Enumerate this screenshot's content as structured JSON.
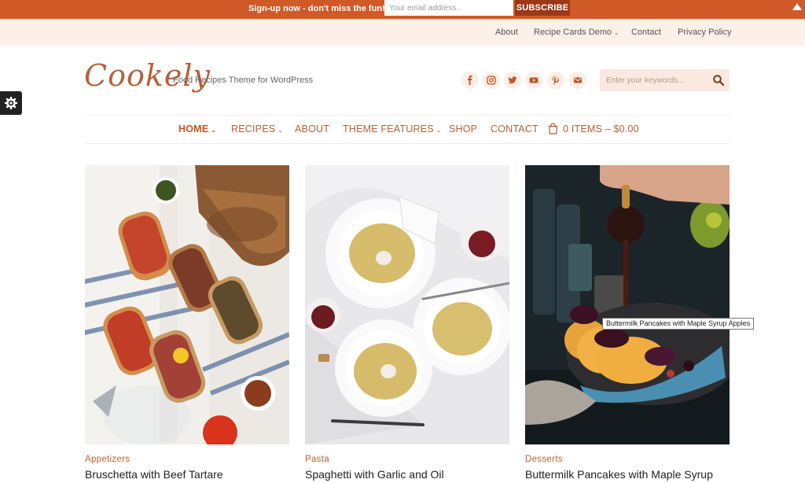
{
  "promo": {
    "text": "Sign-up now - don't miss the fun!",
    "email_placeholder": "Your email address..",
    "subscribe_label": "SUBSCRIBE"
  },
  "subnav": {
    "items": [
      {
        "label": "About"
      },
      {
        "label": "Recipe Cards Demo",
        "has_dropdown": true
      },
      {
        "label": "Contact"
      },
      {
        "label": "Privacy Policy"
      }
    ]
  },
  "header": {
    "logo": "Cookely",
    "tagline": "Food Recipes Theme for WordPress",
    "social_icons": [
      "facebook-icon",
      "instagram-icon",
      "twitter-icon",
      "youtube-icon",
      "pinterest-icon",
      "email-icon"
    ],
    "search_placeholder": "Enter your keywords...",
    "accent_color": "#c45625"
  },
  "nav": {
    "items": [
      {
        "label": "HOME",
        "has_dropdown": true,
        "active": true
      },
      {
        "label": "RECIPES",
        "has_dropdown": true
      },
      {
        "label": "ABOUT"
      },
      {
        "label": "THEME FEATURES",
        "has_dropdown": true
      },
      {
        "label": "SHOP"
      },
      {
        "label": "CONTACT"
      }
    ],
    "cart": "0 ITEMS – $0.00"
  },
  "cards": [
    {
      "category": "Appetizers",
      "title": "Bruschetta with Beef Tartare"
    },
    {
      "category": "Pasta",
      "title": "Spaghetti with Garlic and Oil"
    },
    {
      "category": "Desserts",
      "title": "Buttermilk Pancakes with Maple Syrup"
    }
  ],
  "tooltip": "Buttermilk Pancakes with Maple Syrup Apples"
}
